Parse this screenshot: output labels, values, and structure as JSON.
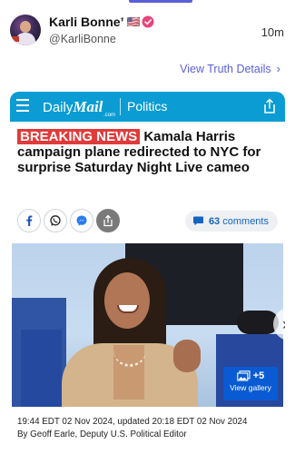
{
  "post": {
    "display_name": "Karli Bonne’",
    "flag_emoji": "🇺🇸",
    "handle": "@KarliBonne",
    "time_ago": "10m",
    "view_details_label": "View Truth Details"
  },
  "article": {
    "site_daily": "Daily",
    "site_mail": "Mail",
    "site_com": ".com",
    "section": "Politics",
    "breaking_label": "BREAKING NEWS",
    "headline": "Kamala Harris campaign plane redirected to NYC for surprise Saturday Night Live cameo",
    "comments_count": "63",
    "comments_label": "comments",
    "gallery_count": "+5",
    "gallery_label": "View gallery",
    "timestamp_line": "19:44 EDT 02 Nov 2024, updated 20:18 EDT 02 Nov 2024",
    "byline": "By Geoff Earle, Deputy U.S. Political Editor"
  },
  "colors": {
    "accent": "#5b5fd6",
    "dailymail_blue": "#0a9cd3",
    "breaking_red": "#e03b3b",
    "gallery_blue": "#0a5bd3",
    "verified_pink": "#e8457a"
  },
  "icons": {
    "share_buttons": [
      "facebook-icon",
      "whatsapp-icon",
      "messenger-icon",
      "share-icon"
    ],
    "comments": "speech-bubble-icon",
    "gallery": "gallery-icon",
    "next": "chevron-right-icon"
  }
}
